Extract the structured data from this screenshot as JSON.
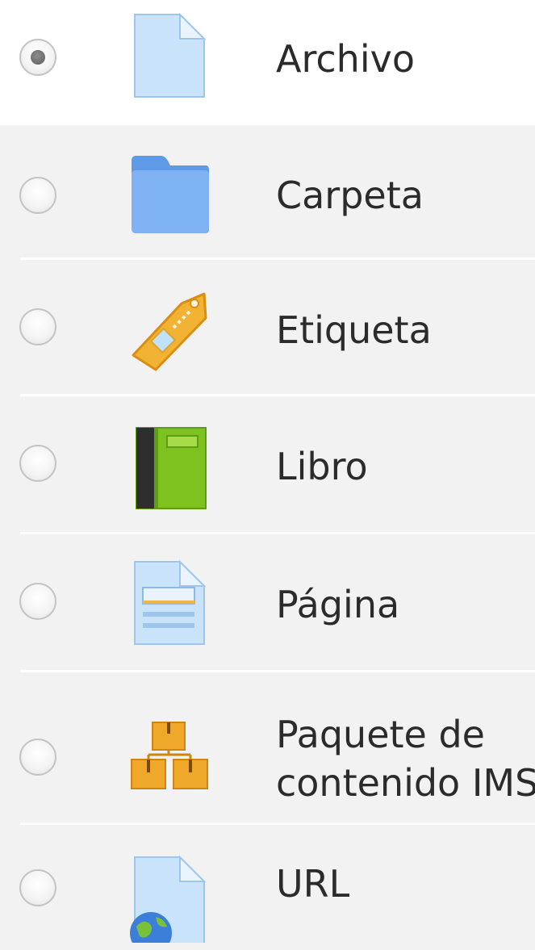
{
  "options": [
    {
      "label": "Archivo",
      "icon": "file-icon",
      "selected": true
    },
    {
      "label": "Carpeta",
      "icon": "folder-icon",
      "selected": false
    },
    {
      "label": "Etiqueta",
      "icon": "label-tag-icon",
      "selected": false
    },
    {
      "label": "Libro",
      "icon": "book-icon",
      "selected": false
    },
    {
      "label": "Página",
      "icon": "page-icon",
      "selected": false
    },
    {
      "label_line1": "Paquete de",
      "label_line2": "contenido IMS",
      "icon": "ims-package-icon",
      "selected": false
    },
    {
      "label": "URL",
      "icon": "url-icon",
      "selected": false
    }
  ],
  "colors": {
    "row_background": "#f2f2f2",
    "selected_background": "#ffffff",
    "text": "#2b2b2b"
  }
}
